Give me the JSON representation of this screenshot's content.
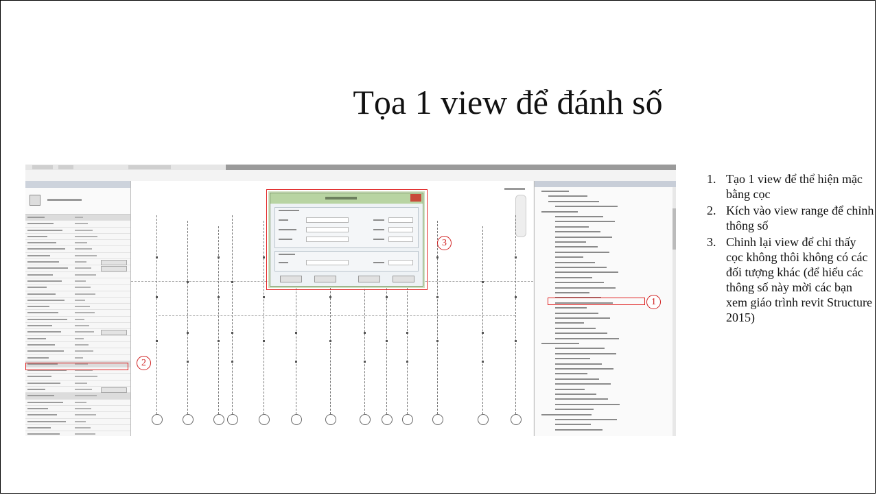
{
  "slide": {
    "title": "Tọa 1 view để đánh số"
  },
  "steps": [
    {
      "num": "1.",
      "text": "Tạo 1 view để thể hiện mặc bằng cọc"
    },
    {
      "num": "2.",
      "text": "Kích vào view range để chỉnh thông số"
    },
    {
      "num": "3.",
      "text": "Chỉnh lại view để chỉ thấy cọc không thôi không có các đối tượng khác (để hiểu các thông số này mời các bạn xem giáo trình revit Structure 2015)"
    }
  ],
  "callouts": {
    "one": "1",
    "two": "2",
    "three": "3"
  },
  "colors": {
    "highlight": "#e02020",
    "dialog_title": "#b8d4a2",
    "close_button": "#c84a3a"
  }
}
